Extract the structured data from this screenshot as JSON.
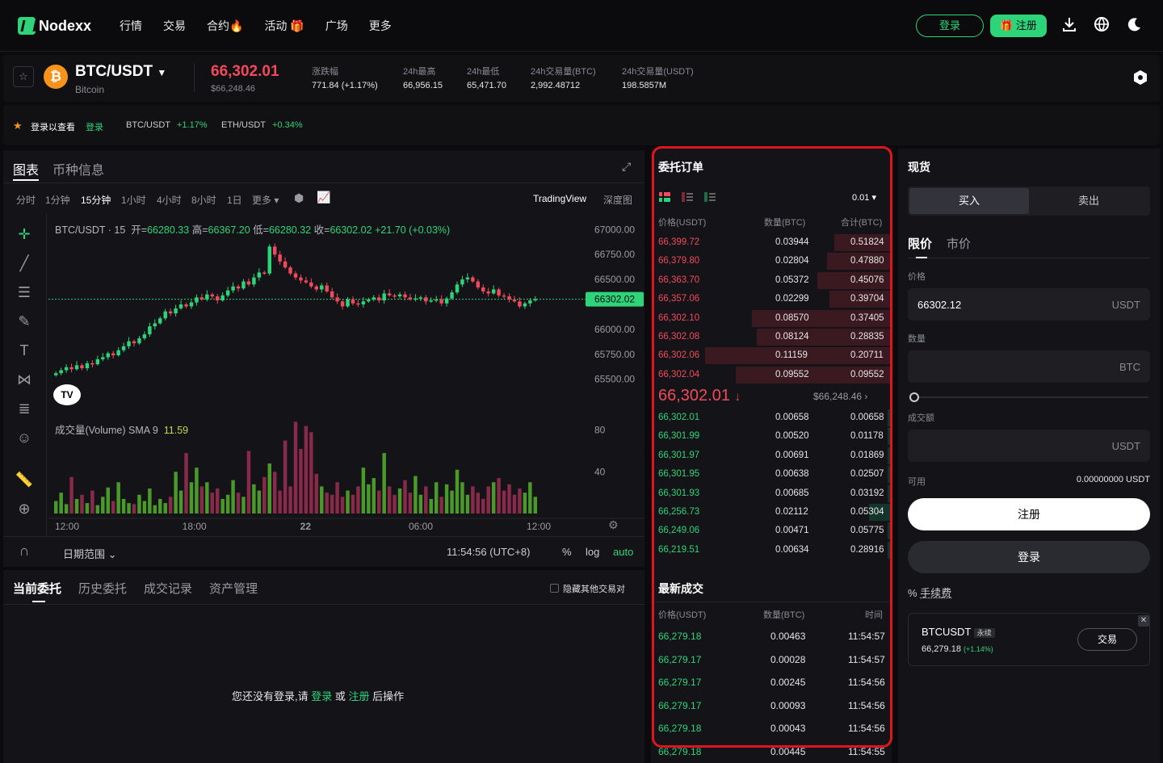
{
  "nav": {
    "logo": "Nodexx",
    "items": [
      "行情",
      "交易",
      "合约🔥",
      "活动 🎁",
      "广场",
      "更多"
    ],
    "login": "登录",
    "register": "注册"
  },
  "ticker": {
    "pair": "BTC/USDT",
    "name": "Bitcoin",
    "coin_symbol": "₿",
    "last_price": "66,302.01",
    "last_usd": "$66,248.46",
    "stats": [
      {
        "label": "涨跌幅",
        "value": "771.84 (+1.17%)"
      },
      {
        "label": "24h最高",
        "value": "66,956.15"
      },
      {
        "label": "24h最低",
        "value": "65,471.70"
      },
      {
        "label": "24h交易量(BTC)",
        "value": "2,992.48712"
      },
      {
        "label": "24h交易量(USDT)",
        "value": "198.5857M"
      }
    ]
  },
  "announcement": {
    "text": "登录以查看",
    "link": "登录",
    "pairs": [
      {
        "name": "BTC/USDT",
        "change": "+1.17%"
      },
      {
        "name": "ETH/USDT",
        "change": "+0.34%"
      }
    ]
  },
  "chart": {
    "tabs": [
      "图表",
      "币种信息"
    ],
    "intervals": [
      "分时",
      "1分钟",
      "15分钟",
      "1小时",
      "4小时",
      "8小时",
      "1日",
      "更多"
    ],
    "active_interval": "15分钟",
    "views": [
      "TradingView",
      "深度图"
    ],
    "legend": {
      "symbol": "BTC/USDT · 15",
      "open_label": "开",
      "open": "66280.33",
      "high_label": "高",
      "high": "66367.20",
      "low_label": "低",
      "low": "66280.32",
      "close_label": "收",
      "close": "66302.02",
      "change": "+21.70 (+0.03%)"
    },
    "volume_label": "成交量(Volume) SMA 9",
    "volume_sma": "11.59",
    "price_ticks": [
      "67000.00",
      "66750.00",
      "66500.00",
      "66000.00",
      "65750.00",
      "65500.00"
    ],
    "current_price_tag": "66302.02",
    "volume_ticks": [
      "80",
      "40"
    ],
    "time_ticks": [
      "12:00",
      "18:00",
      "22",
      "06:00",
      "12:00"
    ],
    "footer": {
      "range": "日期范围",
      "clock": "11:54:56 (UTC+8)",
      "percent": "%",
      "log": "log",
      "auto": "auto"
    }
  },
  "chart_data": {
    "type": "candlestick",
    "title": "BTC/USDT · 15",
    "ylim": [
      65400,
      67100
    ],
    "closes": [
      65560,
      65590,
      65620,
      65600,
      65640,
      65610,
      65660,
      65650,
      65700,
      65720,
      65760,
      65740,
      65790,
      65830,
      65880,
      65860,
      65910,
      65950,
      66030,
      66060,
      66110,
      66180,
      66160,
      66210,
      66250,
      66230,
      66270,
      66320,
      66300,
      66350,
      66330,
      66290,
      66340,
      66390,
      66430,
      66410,
      66480,
      66450,
      66520,
      66570,
      66560,
      66830,
      66750,
      66680,
      66620,
      66560,
      66520,
      66490,
      66470,
      66430,
      66400,
      66440,
      66380,
      66320,
      66280,
      66230,
      66300,
      66260,
      66250,
      66280,
      66300,
      66320,
      66290,
      66360,
      66340,
      66330,
      66350,
      66320,
      66300,
      66310,
      66320,
      66280,
      66290,
      66300,
      66260,
      66310,
      66370,
      66450,
      66500,
      66520,
      66480,
      66420,
      66380,
      66360,
      66400,
      66340,
      66330,
      66300,
      66280,
      66230,
      66260,
      66290,
      66302
    ],
    "volume_ylim": [
      0,
      110
    ],
    "volumes": [
      12,
      20,
      9,
      35,
      14,
      18,
      10,
      22,
      8,
      16,
      25,
      12,
      30,
      14,
      10,
      9,
      18,
      12,
      24,
      8,
      14,
      10,
      16,
      40,
      22,
      58,
      30,
      44,
      26,
      30,
      20,
      24,
      14,
      18,
      32,
      20,
      16,
      60,
      28,
      22,
      35,
      48,
      40,
      22,
      70,
      26,
      88,
      62,
      84,
      78,
      38,
      26,
      20,
      18,
      30,
      16,
      22,
      18,
      26,
      44,
      28,
      34,
      22,
      58,
      26,
      18,
      24,
      32,
      20,
      36,
      18,
      26,
      14,
      30,
      16,
      28,
      22,
      42,
      30,
      18,
      26,
      20,
      14,
      26,
      30,
      34,
      22,
      28,
      18,
      24,
      20,
      30,
      16
    ],
    "volume_sma": 11.59
  },
  "orders": {
    "tabs": [
      "当前委托",
      "历史委托",
      "成交记录",
      "资产管理"
    ],
    "hide_label": "隐藏其他交易对",
    "empty_prefix": "您还没有登录,请",
    "empty_login": "登录",
    "empty_or": "或",
    "empty_register": "注册",
    "empty_suffix": "后操作"
  },
  "orderbook": {
    "title": "委托订单",
    "precision": "0.01",
    "headers": [
      "价格(USDT)",
      "数量(BTC)",
      "合计(BTC)"
    ],
    "asks": [
      {
        "price": "66,399.72",
        "qty": "0.03944",
        "total": "0.51824",
        "depth": 0.25
      },
      {
        "price": "66,379.80",
        "qty": "0.02804",
        "total": "0.47880",
        "depth": 0.28
      },
      {
        "price": "66,363.70",
        "qty": "0.05372",
        "total": "0.45076",
        "depth": 0.32
      },
      {
        "price": "66,357.06",
        "qty": "0.02299",
        "total": "0.39704",
        "depth": 0.27
      },
      {
        "price": "66,302.10",
        "qty": "0.08570",
        "total": "0.37405",
        "depth": 0.6
      },
      {
        "price": "66,302.08",
        "qty": "0.08124",
        "total": "0.28835",
        "depth": 0.58
      },
      {
        "price": "66,302.06",
        "qty": "0.11159",
        "total": "0.20711",
        "depth": 0.8
      },
      {
        "price": "66,302.04",
        "qty": "0.09552",
        "total": "0.09552",
        "depth": 0.67
      }
    ],
    "mid_price": "66,302.01",
    "mid_usd": "$66,248.46",
    "bids": [
      {
        "price": "66,302.01",
        "qty": "0.00658",
        "total": "0.00658",
        "depth": 0.02
      },
      {
        "price": "66,301.99",
        "qty": "0.00520",
        "total": "0.01178",
        "depth": 0.02
      },
      {
        "price": "66,301.97",
        "qty": "0.00691",
        "total": "0.01869",
        "depth": 0.02
      },
      {
        "price": "66,301.95",
        "qty": "0.00638",
        "total": "0.02507",
        "depth": 0.02
      },
      {
        "price": "66,301.93",
        "qty": "0.00685",
        "total": "0.03192",
        "depth": 0.02
      },
      {
        "price": "66,256.73",
        "qty": "0.02112",
        "total": "0.05304",
        "depth": 0.1
      },
      {
        "price": "66,249.06",
        "qty": "0.00471",
        "total": "0.05775",
        "depth": 0.02
      },
      {
        "price": "66,219.51",
        "qty": "0.00634",
        "total": "0.28916",
        "depth": 0.02
      }
    ]
  },
  "trades": {
    "title": "最新成交",
    "headers": [
      "价格(USDT)",
      "数量(BTC)",
      "时间"
    ],
    "rows": [
      {
        "price": "66,279.18",
        "qty": "0.00463",
        "time": "11:54:57"
      },
      {
        "price": "66,279.17",
        "qty": "0.00028",
        "time": "11:54:57"
      },
      {
        "price": "66,279.17",
        "qty": "0.00245",
        "time": "11:54:56"
      },
      {
        "price": "66,279.17",
        "qty": "0.00093",
        "time": "11:54:56"
      },
      {
        "price": "66,279.18",
        "qty": "0.00043",
        "time": "11:54:56"
      },
      {
        "price": "66,279.18",
        "qty": "0.00445",
        "time": "11:54:55"
      }
    ]
  },
  "spot": {
    "title": "现货",
    "buy": "买入",
    "sell": "卖出",
    "order_types": [
      "限价",
      "市价"
    ],
    "price_label": "价格",
    "price_value": "66302.12",
    "price_unit": "USDT",
    "qty_label": "数量",
    "qty_unit": "BTC",
    "amount_label": "成交额",
    "amount_unit": "USDT",
    "available_label": "可用",
    "available_value": "0.00000000 USDT",
    "register_btn": "注册",
    "login_btn": "登录",
    "fee_label": "手续费",
    "promo": {
      "pair": "BTCUSDT",
      "tag": "永续",
      "price": "66,279.18",
      "change": "(+1.14%)",
      "button": "交易"
    }
  },
  "colors": {
    "up": "#2ed47a",
    "down": "#f2495c",
    "accent": "#2ed47a",
    "highlight_frame": "#e0141e"
  }
}
